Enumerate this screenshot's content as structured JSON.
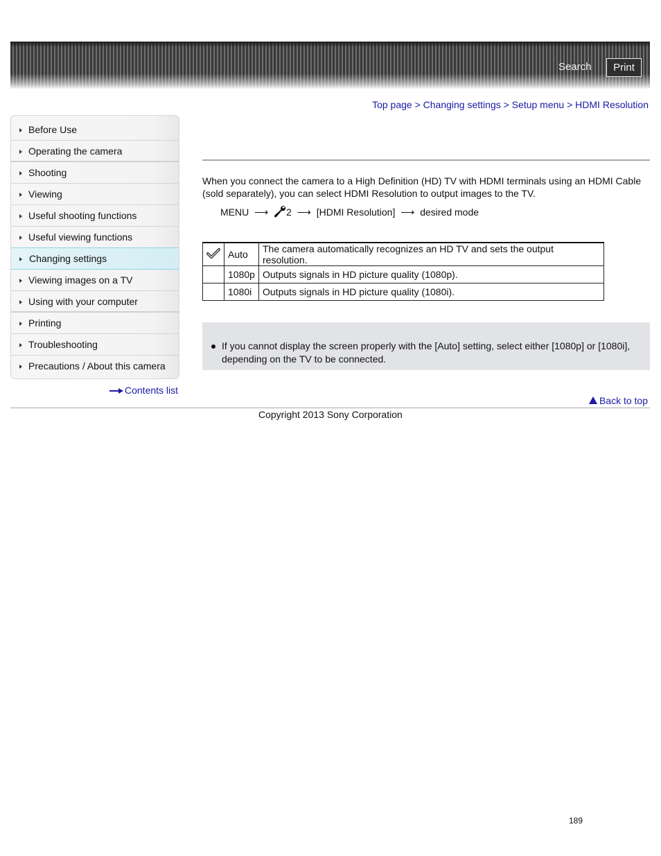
{
  "header": {
    "search_label": "Search",
    "print_label": "Print"
  },
  "breadcrumb": {
    "items": [
      "Top page",
      "Changing settings",
      "Setup menu",
      "HDMI Resolution"
    ],
    "separator": ">"
  },
  "sidebar": {
    "items": [
      {
        "label": "Before Use",
        "active": false
      },
      {
        "label": "Operating the camera",
        "active": false
      },
      {
        "label": "Shooting",
        "active": false
      },
      {
        "label": "Viewing",
        "active": false
      },
      {
        "label": "Useful shooting functions",
        "active": false
      },
      {
        "label": "Useful viewing functions",
        "active": false
      },
      {
        "label": "Changing settings",
        "active": true
      },
      {
        "label": "Viewing images on a TV",
        "active": false
      },
      {
        "label": "Using with your computer",
        "active": false
      },
      {
        "label": "Printing",
        "active": false
      },
      {
        "label": "Troubleshooting",
        "active": false
      },
      {
        "label": "Precautions / About this camera",
        "active": false
      }
    ],
    "contents_link": "Contents list"
  },
  "main": {
    "intro": "When you connect the camera to a High Definition (HD) TV with HDMI terminals using an HDMI Cable (sold separately), you can select HDMI Resolution to output images to the TV.",
    "menu_path": {
      "menu": "MENU",
      "arrow": "⟶",
      "setup_icon": "wrench-icon",
      "setup_num": "2",
      "item": "[HDMI Resolution]",
      "target": "desired mode"
    },
    "options": [
      {
        "default": true,
        "mode": "Auto",
        "description": "The camera automatically recognizes an HD TV and sets the output resolution."
      },
      {
        "default": false,
        "mode": "1080p",
        "description": "Outputs signals in HD picture quality (1080p)."
      },
      {
        "default": false,
        "mode": "1080i",
        "description": "Outputs signals in HD picture quality (1080i)."
      }
    ],
    "notes": [
      "If you cannot display the screen properly with the [Auto] setting, select either [1080p] or [1080i], depending on the TV to be connected."
    ]
  },
  "footer": {
    "back_to_top": "Back to top",
    "copyright": "Copyright 2013 Sony Corporation",
    "page_number": "189"
  },
  "colors": {
    "link": "#1a1aa6",
    "active_item_bg": "#d4eef4",
    "active_item_border": "#8fd4e6",
    "note_bg": "#e2e3e6"
  }
}
